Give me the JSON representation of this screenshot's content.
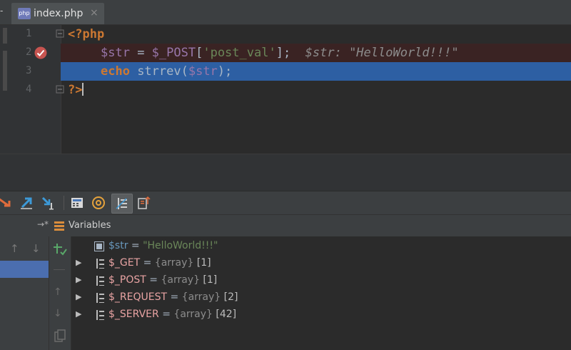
{
  "tab": {
    "stub": "-",
    "icon_label": "php",
    "filename": "index.php",
    "close": "×"
  },
  "editor": {
    "lines": [
      {
        "num": "1",
        "open": "<?php"
      },
      {
        "num": "2",
        "var": "$str",
        "eq": " = ",
        "post": "$_POST",
        "lb": "[",
        "key": "'post_val'",
        "rb": "];",
        "hint": "  $str: \"HelloWorld!!!\""
      },
      {
        "num": "3",
        "kw": "echo",
        "fn": " strrev(",
        "var": "$str",
        "close": ");"
      },
      {
        "num": "4",
        "close_tag": "?>"
      }
    ],
    "breakpoint_line": 2,
    "execution_line": 3
  },
  "variables_panel": {
    "title": "Variables",
    "pin": "→*",
    "items": [
      {
        "name": "$str",
        "eq": " = ",
        "value": "\"HelloWorld!!!\"",
        "kind": "string",
        "expandable": false
      },
      {
        "name": "$_GET",
        "eq": " = ",
        "type": "{array}",
        "count": " [1]",
        "kind": "array",
        "expandable": true
      },
      {
        "name": "$_POST",
        "eq": " = ",
        "type": "{array}",
        "count": " [1]",
        "kind": "array",
        "expandable": true
      },
      {
        "name": "$_REQUEST",
        "eq": " = ",
        "type": "{array}",
        "count": " [2]",
        "kind": "array",
        "expandable": true
      },
      {
        "name": "$_SERVER",
        "eq": " = ",
        "type": "{array}",
        "count": " [42]",
        "kind": "array",
        "expandable": true
      }
    ]
  },
  "glyphs": {
    "expand": "▶",
    "up": "↑",
    "down": "↓"
  },
  "colors": {
    "selection": "#2d5fa3",
    "breakpoint_line": "#3a2323",
    "breakpoint": "#c75450",
    "frame_selected": "#4b6eaf"
  }
}
